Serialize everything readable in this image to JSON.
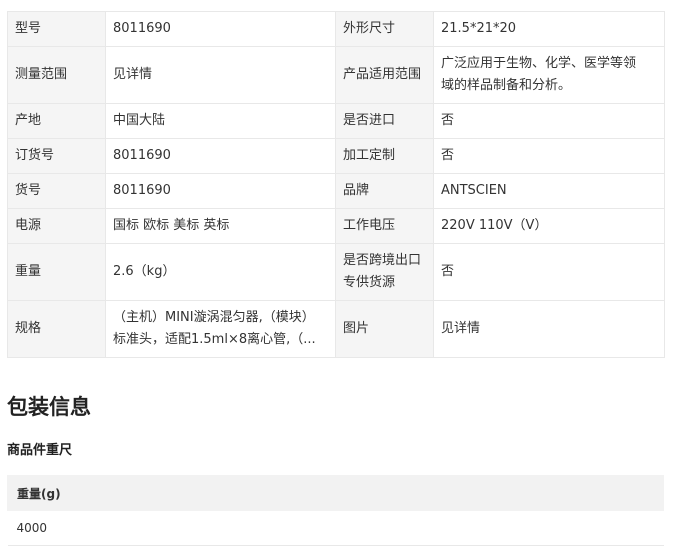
{
  "spec": {
    "model_label": "型号",
    "model_value": "8011690",
    "size_label": "外形尺寸",
    "size_value": "21.5*21*20",
    "range_label": "测量范围",
    "range_value": "见详情",
    "scope_label": "产品适用范围",
    "scope_value_line1": "广泛应用于生物、化学、医学等领",
    "scope_value_line2": "域的样品制备和分析。",
    "origin_label": "产地",
    "origin_value": "中国大陆",
    "import_label": "是否进口",
    "import_value": "否",
    "order_label": "订货号",
    "order_value": "8011690",
    "custom_label": "加工定制",
    "custom_value": "否",
    "item_label": "货号",
    "item_value": "8011690",
    "brand_label": "品牌",
    "brand_value": "ANTSCIEN",
    "power_label": "电源",
    "power_value": "国标 欧标 美标 英标",
    "voltage_label": "工作电压",
    "voltage_value": "220V 110V（V）",
    "weight_label": "重量",
    "weight_value": "2.6（kg）",
    "crossborder_label_line1": "是否跨境出口",
    "crossborder_label_line2": "专供货源",
    "crossborder_value": "否",
    "spec_label": "规格",
    "spec_value_line1": "（主机）MINI漩涡混匀器,（模块）",
    "spec_value_line2": "标准头，适配1.5ml×8离心管,（...",
    "image_label": "图片",
    "image_value": "见详情"
  },
  "packaging": {
    "title": "包装信息",
    "subtitle": "商品件重尺",
    "header_weight": "重量(g)",
    "row_weight": "4000"
  }
}
